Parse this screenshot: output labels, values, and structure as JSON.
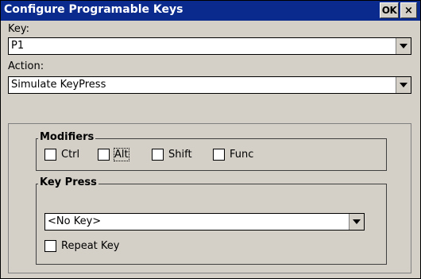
{
  "window": {
    "title": "Configure Programable Keys",
    "ok_label": "OK",
    "close_label": "×"
  },
  "key_field": {
    "label": "Key:",
    "value": "P1"
  },
  "action_field": {
    "label": "Action:",
    "value": "Simulate KeyPress"
  },
  "modifiers": {
    "title": "Modifiers",
    "items": [
      {
        "label": "Ctrl",
        "checked": false
      },
      {
        "label": "Alt",
        "checked": false
      },
      {
        "label": "Shift",
        "checked": false
      },
      {
        "label": "Func",
        "checked": false
      }
    ]
  },
  "key_press": {
    "title": "Key Press",
    "key_value": "<No Key>",
    "repeat_label": "Repeat Key",
    "repeat_checked": false
  }
}
